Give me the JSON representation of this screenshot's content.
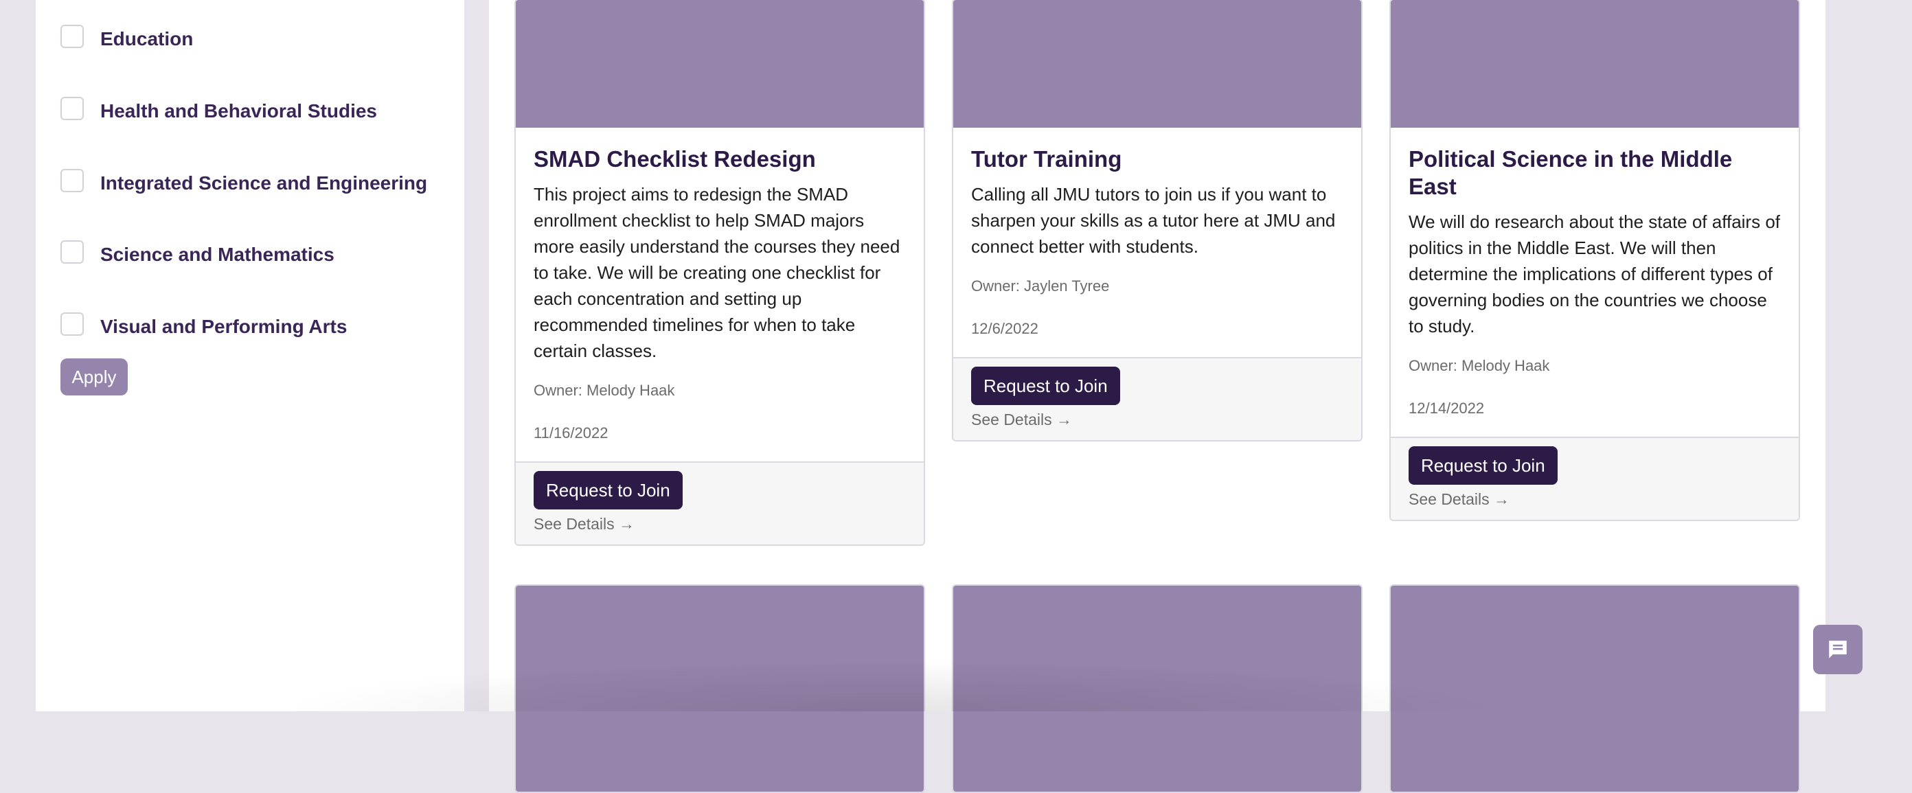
{
  "filters": {
    "items": [
      {
        "label": "Education",
        "checked": false
      },
      {
        "label": "Health and Behavioral Studies",
        "checked": false
      },
      {
        "label": "Integrated Science and Engineering",
        "checked": false
      },
      {
        "label": "Science and Mathematics",
        "checked": false
      },
      {
        "label": "Visual and Performing Arts",
        "checked": false
      }
    ],
    "apply_label": "Apply"
  },
  "projects": [
    {
      "title": "SMAD Checklist Redesign",
      "description": "This project aims to redesign the SMAD enrollment checklist to help SMAD majors more easily understand the courses they need to take. We will be creating one checklist for each concentration and setting up recommended timelines for when to take certain classes.",
      "owner": "Owner: Melody Haak",
      "date": "11/16/2022",
      "join_label": "Request to Join",
      "details_label": "See Details →"
    },
    {
      "title": "Tutor Training",
      "description": "Calling all JMU tutors to join us if you want to sharpen your skills as a tutor here at JMU and connect better with students.",
      "owner": "Owner: Jaylen Tyree",
      "date": "12/6/2022",
      "join_label": "Request to Join",
      "details_label": "See Details →"
    },
    {
      "title": "Political Science in the Middle East",
      "description": "We will do research about the state of affairs of politics in the Middle East. We will then determine the implications of different types of governing bodies on the countries we choose to study.",
      "owner": "Owner: Melody Haak",
      "date": "12/14/2022",
      "join_label": "Request to Join",
      "details_label": "See Details →"
    }
  ],
  "colors": {
    "accent": "#2c1a47",
    "card_image": "#9584ab",
    "background": "#e8e4ec"
  },
  "chat": {
    "icon": "chat-bubble-icon"
  }
}
